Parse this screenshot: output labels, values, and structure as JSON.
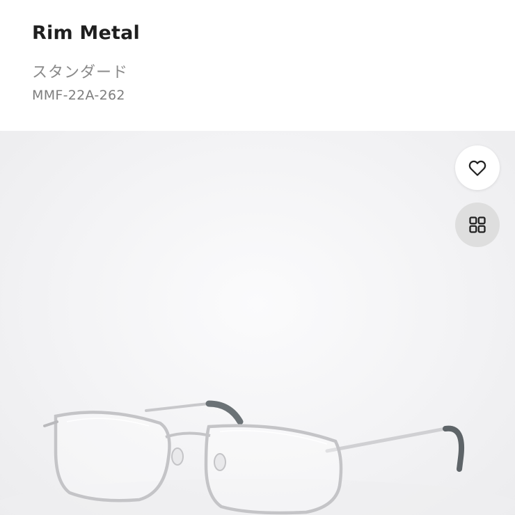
{
  "product": {
    "name": "Rim Metal",
    "category": "スタンダード",
    "model_code": "MMF-22A-262"
  },
  "actions": {
    "favorite_icon": "heart-icon",
    "view_toggle_icon": "grid-icon"
  },
  "colors": {
    "title": "#1f1f1f",
    "subtitle": "#8a8a8a",
    "grid_button_bg": "#dedede",
    "frame_silver": "#c9c9cc",
    "temple_tip": "#5e6468"
  }
}
